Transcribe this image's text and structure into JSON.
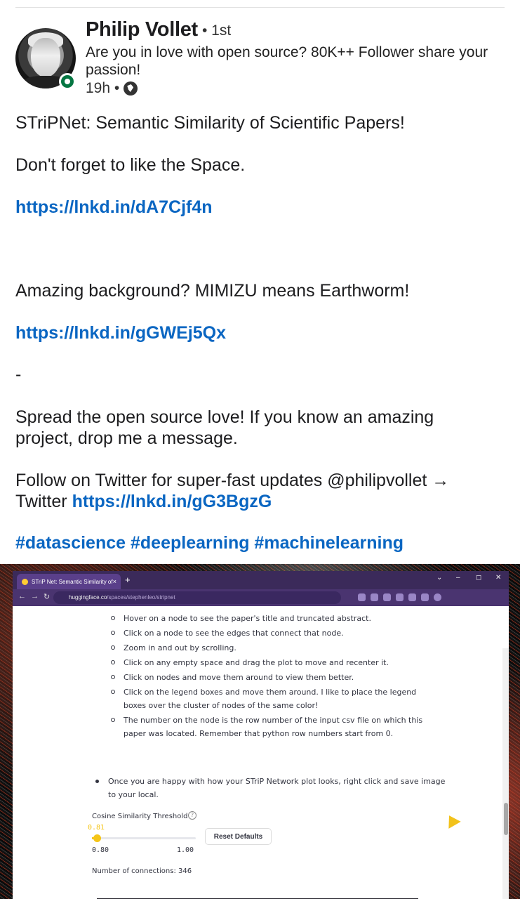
{
  "post": {
    "author": "Philip Vollet",
    "degree": "• 1st",
    "headline": "Are you in love with open source? 80K++ Follower share your passion!",
    "time": "19h •",
    "title_line": "STriPNet: Semantic Similarity of Scientific Papers!",
    "like_line": "Don't forget to like the Space.",
    "link1": "https://lnkd.in/dA7Cjf4n",
    "background_line": "Amazing background? MIMIZU means Earthworm!",
    "link2": "https://lnkd.in/gGWEj5Qx",
    "dash": "-",
    "spread_line": "Spread the open source love! If you know an amazing project, drop me a message.",
    "follow_line": "Follow on Twitter for super-fast updates @philipvollet → Twitter",
    "link3": "https://lnkd.in/gG3BgzG",
    "hashtags": "#datascience #deeplearning #machinelearning"
  },
  "browser": {
    "tab_title": "STriP Net: Semantic Similarity of",
    "tab_close": "×",
    "new_tab": "+",
    "url_host": "huggingface.co",
    "url_path": "/spaces/stephenleo/stripnet",
    "win_min": "–",
    "win_max": "◻",
    "win_close": "✕",
    "chevron": "⌄"
  },
  "app": {
    "instructions": [
      "Hover on a node to see the paper's title and truncated abstract.",
      "Click on a node to see the edges that connect that node.",
      "Zoom in and out by scrolling.",
      "Click on any empty space and drag the plot to move and recenter it.",
      "Click on nodes and move them around to view them better.",
      "Click on the legend boxes and move them around. I like to place the legend boxes over the cluster of nodes of the same color!",
      "The number on the node is the row number of the input csv file on which this paper was located. Remember that python row numbers start from 0."
    ],
    "main_bullet": "Once you are happy with how your STriP Network plot looks, right click and save image to your local.",
    "slider_label": "Cosine Similarity Threshold",
    "slider_value": "0.81",
    "slider_value_frac": 0.05,
    "slider_min": "0.80",
    "slider_max": "1.00",
    "reset_label": "Reset Defaults",
    "connections": "Number of connections: 346",
    "accent": "#f5c518"
  },
  "colors": {
    "link": "#0a66c2",
    "online": "#057642",
    "browser_chrome": "#3b2a5a"
  }
}
